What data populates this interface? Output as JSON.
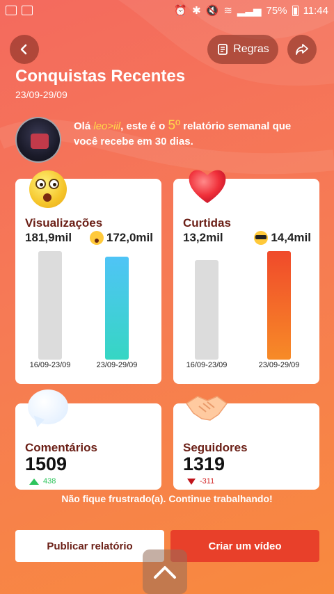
{
  "status_bar": {
    "battery": "75%",
    "time": "11:44"
  },
  "header": {
    "rules_label": "Regras",
    "title": "Conquistas Recentes",
    "date_range": "23/09-29/09"
  },
  "intro": {
    "greeting": "Olá ",
    "username": "leo>iil",
    "middle": ", este é o ",
    "ordinal": "5º",
    "end": " relatório semanal que você recebe em 30 dias."
  },
  "views": {
    "title": "Visualizações",
    "previous": "181,9mil",
    "current": "172,0mil",
    "prev_label": "16/09-23/09",
    "cur_label": "23/09-29/09",
    "prev_value": 181.9,
    "cur_value": 172.0
  },
  "likes": {
    "title": "Curtidas",
    "previous": "13,2mil",
    "current": "14,4mil",
    "prev_label": "16/09-23/09",
    "cur_label": "23/09-29/09",
    "prev_value": 13.2,
    "cur_value": 14.4
  },
  "comments": {
    "title": "Comentários",
    "value": "1509",
    "delta": "438",
    "trend": "up"
  },
  "followers": {
    "title": "Seguidores",
    "value": "1319",
    "delta": "-311",
    "trend": "down"
  },
  "motivation": "Não fique frustrado(a). Continue trabalhando!",
  "actions": {
    "publish": "Publicar relatório",
    "create_video": "Criar um vídeo"
  },
  "colors": {
    "accent": "#e8402a",
    "title_dark": "#6b1f16",
    "up": "#2ec45c",
    "down": "#c0141a"
  }
}
